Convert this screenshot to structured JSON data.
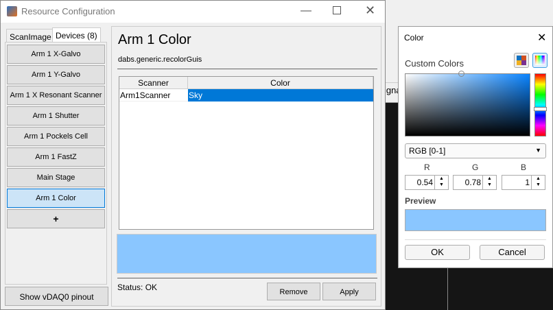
{
  "background": {
    "partial_label": "igna"
  },
  "window": {
    "title": "Resource Configuration",
    "controls": [
      "minimize",
      "maximize",
      "close"
    ]
  },
  "tabs": [
    {
      "label": "ScanImage"
    },
    {
      "label": "Devices (8)",
      "active": true
    }
  ],
  "devices": [
    {
      "label": "Arm 1 X-Galvo"
    },
    {
      "label": "Arm 1 Y-Galvo"
    },
    {
      "label": "Arm 1 X Resonant Scanner"
    },
    {
      "label": "Arm 1 Shutter"
    },
    {
      "label": "Arm 1 Pockels Cell"
    },
    {
      "label": "Arm 1 FastZ"
    },
    {
      "label": "Main Stage"
    },
    {
      "label": "Arm 1 Color",
      "selected": true
    }
  ],
  "add_label": "+",
  "pinout_label": "Show vDAQ0 pinout",
  "main": {
    "title": "Arm 1 Color",
    "class_name": "dabs.generic.recolorGuis",
    "table": {
      "columns": [
        "Scanner",
        "Color"
      ],
      "rows": [
        [
          "Arm1Scanner",
          "Sky"
        ]
      ]
    },
    "preview_color": "#8ac6ff",
    "status": "Status: OK",
    "remove_label": "Remove",
    "apply_label": "Apply"
  },
  "color_dialog": {
    "title": "Color",
    "custom_colors_label": "Custom Colors",
    "mode": "RGB [0-1]",
    "channels": [
      {
        "label": "R",
        "value": "0.54"
      },
      {
        "label": "G",
        "value": "0.78"
      },
      {
        "label": "B",
        "value": "1"
      }
    ],
    "preview_label": "Preview",
    "preview_color": "#8ac6ff",
    "ok_label": "OK",
    "cancel_label": "Cancel",
    "selection_color": "#0078d7"
  }
}
